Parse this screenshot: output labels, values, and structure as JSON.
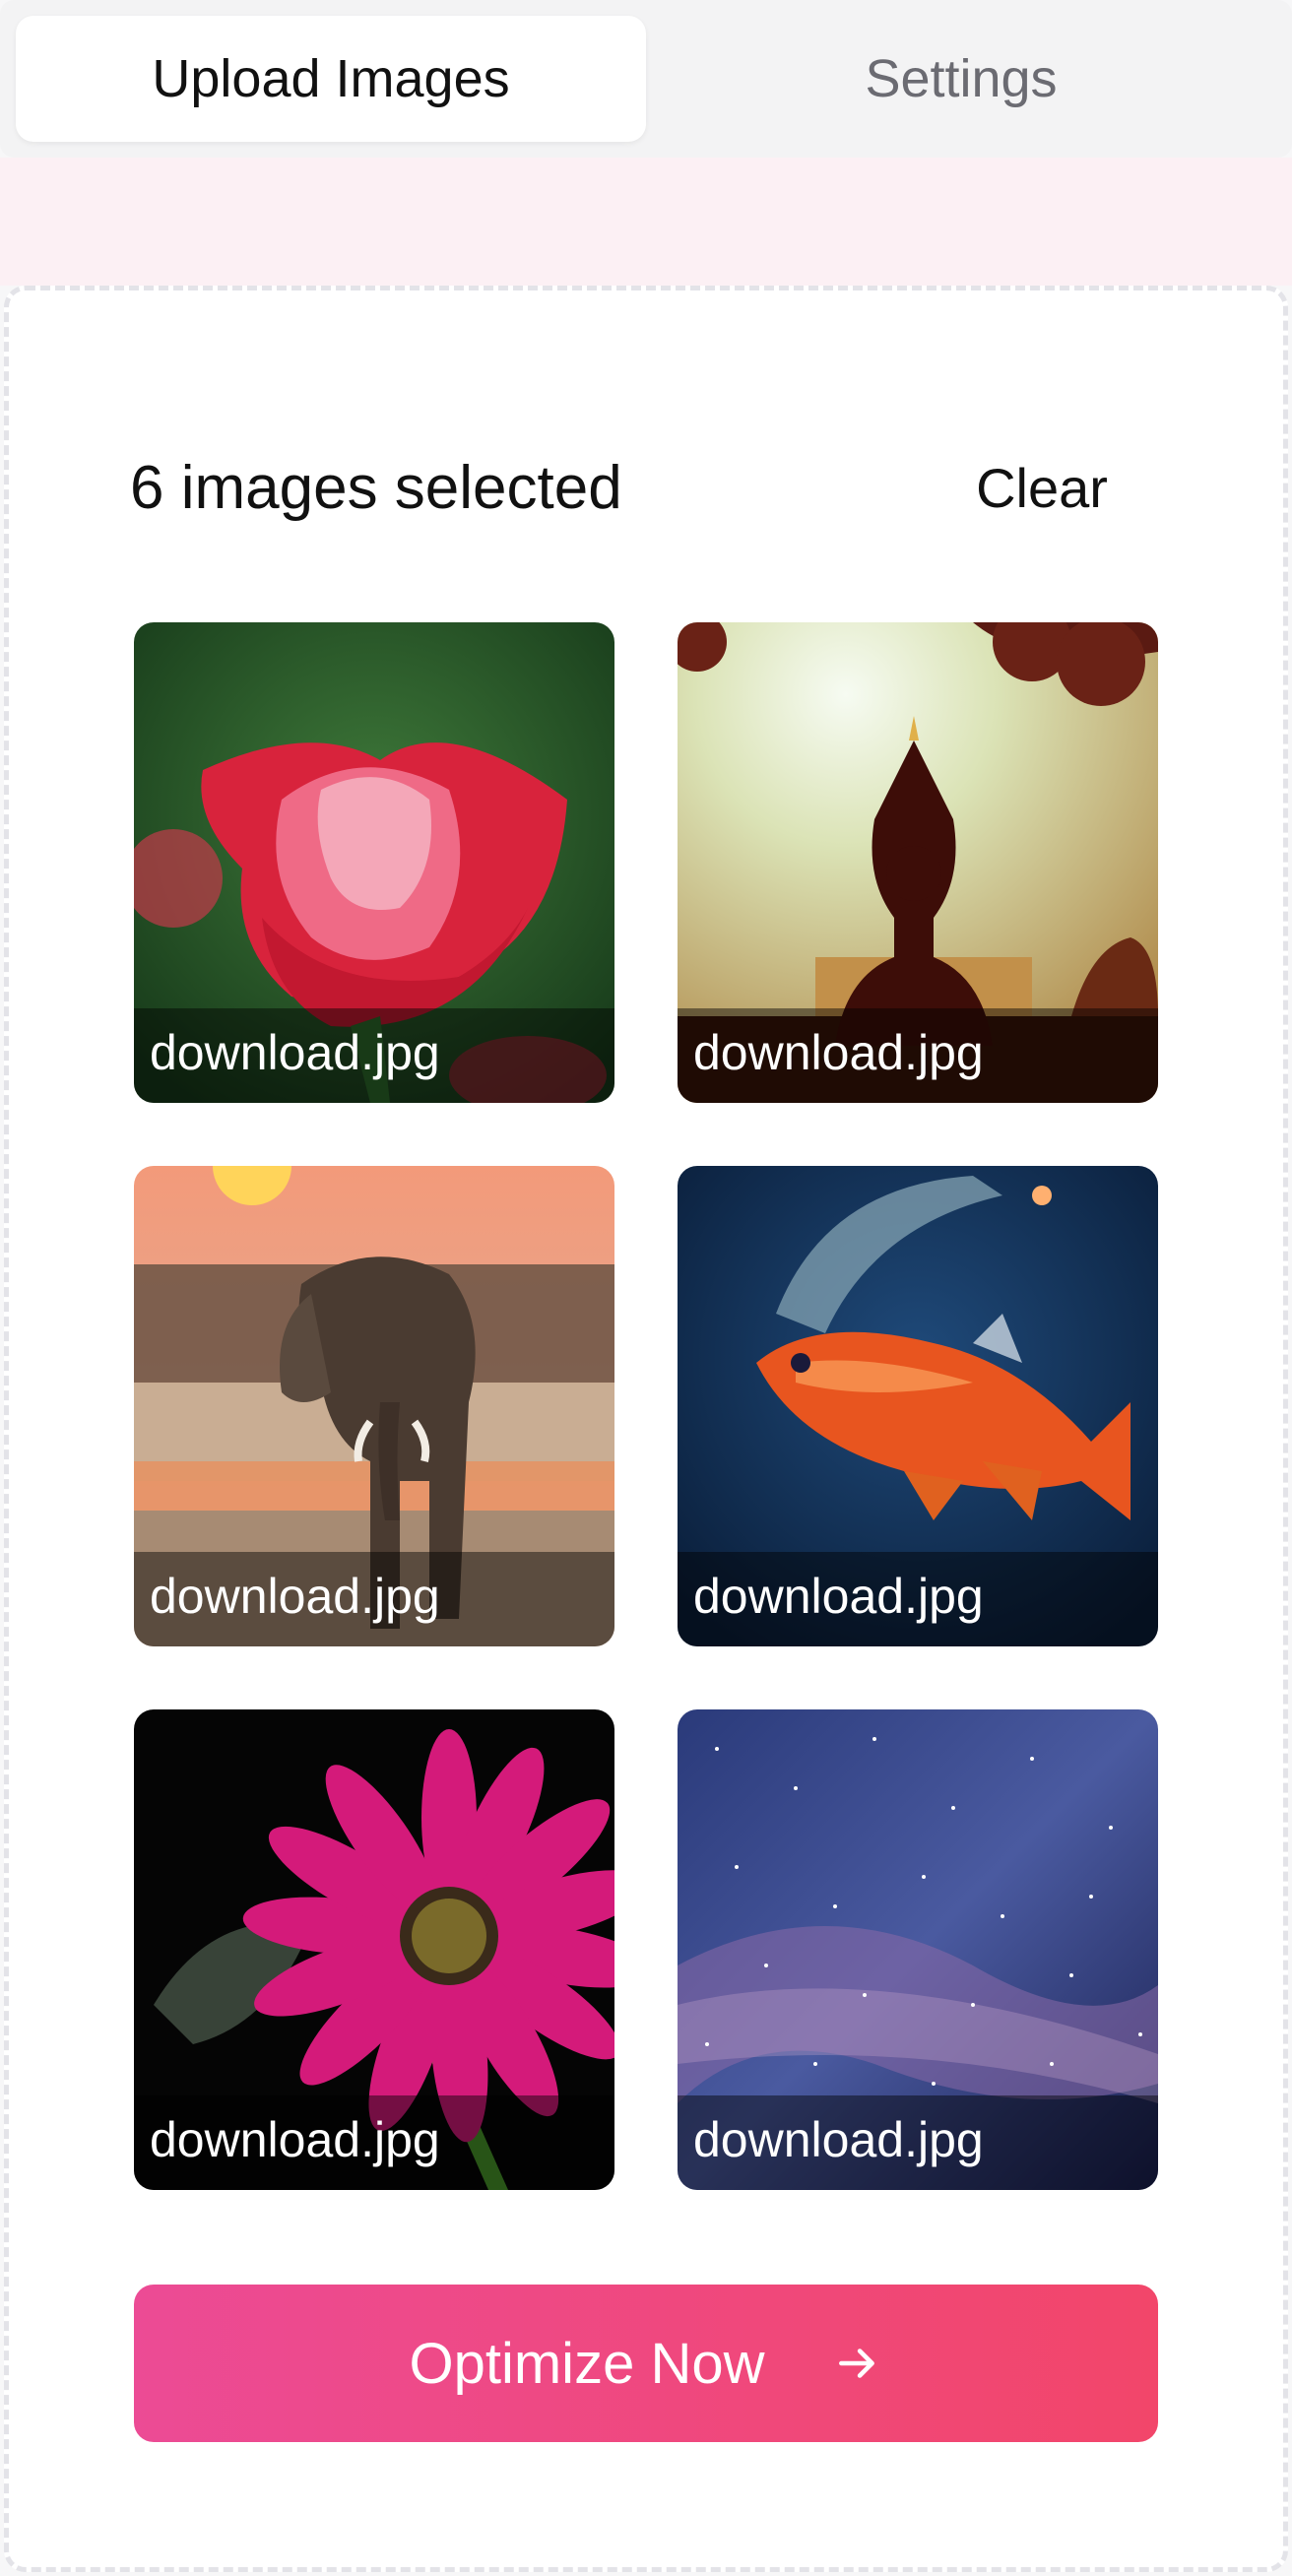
{
  "tabs": [
    {
      "label": "Upload Images",
      "active": true
    },
    {
      "label": "Settings",
      "active": false
    }
  ],
  "selection": {
    "count_text": "6 images selected",
    "clear_label": "Clear"
  },
  "images": [
    {
      "filename": "download.jpg",
      "subject": "red rose"
    },
    {
      "filename": "download.jpg",
      "subject": "yoga silhouette at sunset"
    },
    {
      "filename": "download.jpg",
      "subject": "elephant at sunset"
    },
    {
      "filename": "download.jpg",
      "subject": "orange fish underwater"
    },
    {
      "filename": "download.jpg",
      "subject": "pink daisy flower"
    },
    {
      "filename": "download.jpg",
      "subject": "starry night sky"
    }
  ],
  "cta": {
    "label": "Optimize Now",
    "icon": "arrow-right-icon"
  },
  "colors": {
    "accent_start": "#ec4b95",
    "accent_end": "#f2466a",
    "panel_border": "#e3e3e8",
    "pink_background": "#fcf0f4"
  }
}
